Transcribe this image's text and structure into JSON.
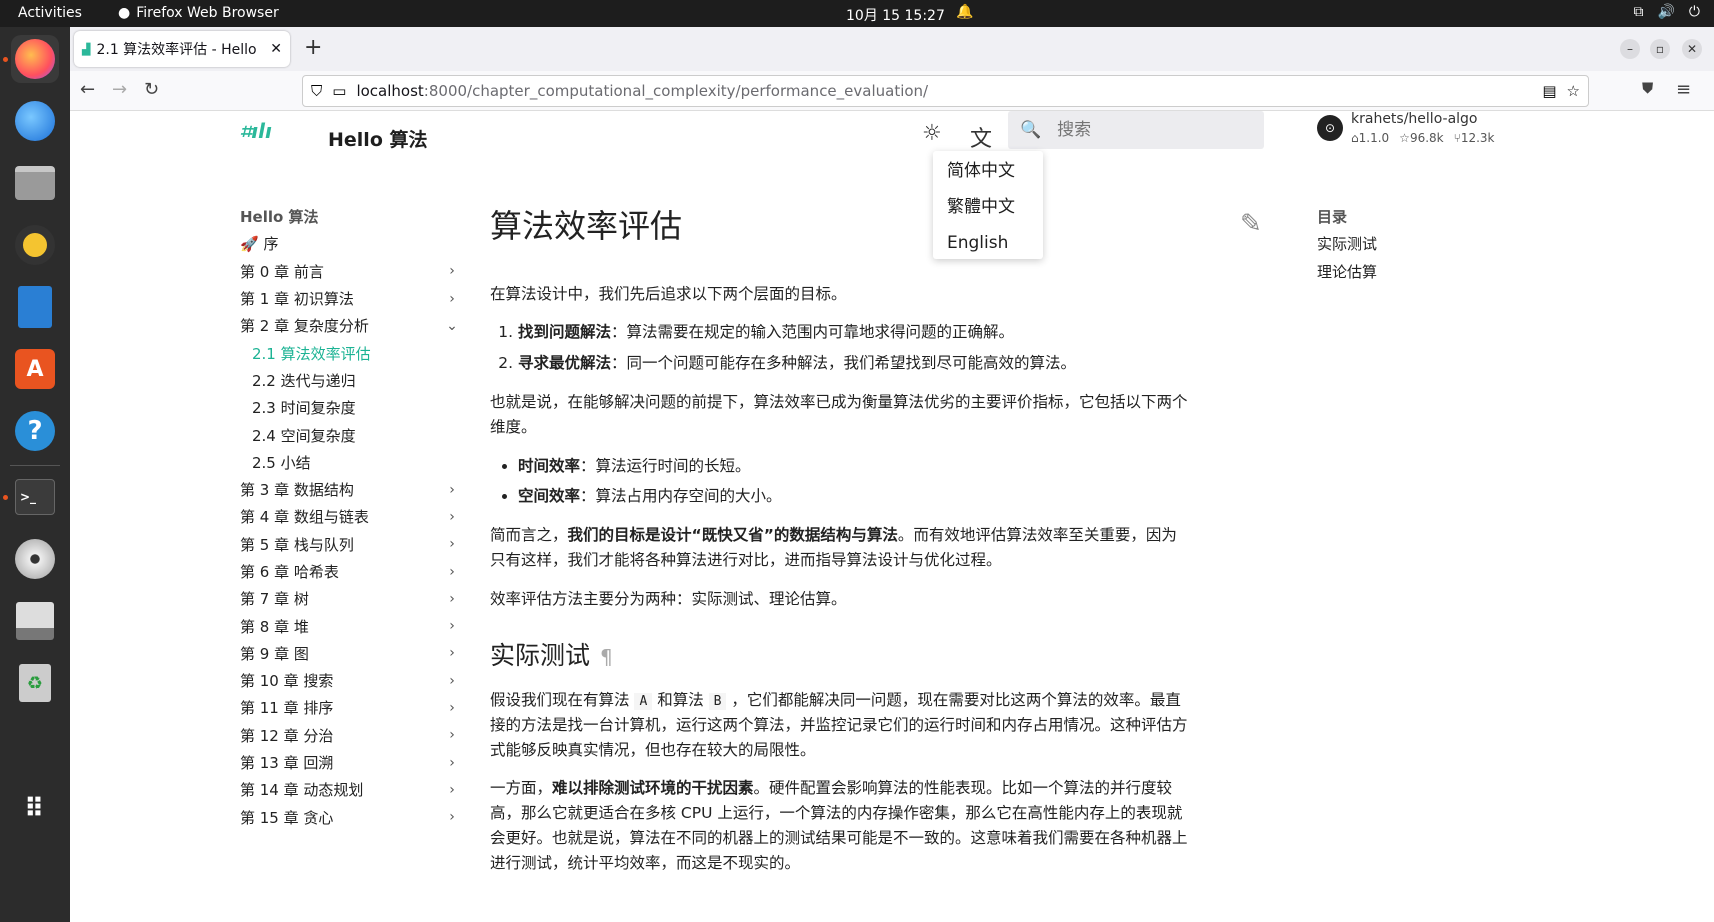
{
  "topbar": {
    "activities": "Activities",
    "app_name": "Firefox Web Browser",
    "clock": "10月 15  15:27"
  },
  "dock": {
    "items": [
      "firefox-icon",
      "thunderbird-icon",
      "files-icon",
      "rhythmbox-icon",
      "writer-icon",
      "app-center-icon",
      "help-icon",
      "terminal-icon",
      "dvd-icon",
      "save-icon",
      "trash-icon",
      "apps-grid-icon"
    ]
  },
  "browser": {
    "tab_title": "2.1  算法效率评估 - Hello",
    "url_host": "localhost",
    "url_path": ":8000/chapter_computational_complexity/performance_evaluation/"
  },
  "header": {
    "site_title": "Hello 算法",
    "search_placeholder": "搜索",
    "repo_name": "krahets/hello-algo",
    "repo_version": "1.1.0",
    "repo_stars": "96.8k",
    "repo_forks": "12.3k"
  },
  "lang_menu": [
    "简体中文",
    "繁體中文",
    "English"
  ],
  "nav": {
    "head": "Hello 算法",
    "items": [
      {
        "label": "序"
      },
      {
        "label": "第 0 章   前言"
      },
      {
        "label": "第 1 章   初识算法"
      },
      {
        "label": "第 2 章   复杂度分析"
      },
      {
        "label": "2.1   算法效率评估"
      },
      {
        "label": "2.2   迭代与递归"
      },
      {
        "label": "2.3   时间复杂度"
      },
      {
        "label": "2.4   空间复杂度"
      },
      {
        "label": "2.5   小结"
      },
      {
        "label": "第 3 章   数据结构"
      },
      {
        "label": "第 4 章   数组与链表"
      },
      {
        "label": "第 5 章   栈与队列"
      },
      {
        "label": "第 6 章   哈希表"
      },
      {
        "label": "第 7 章   树"
      },
      {
        "label": "第 8 章   堆"
      },
      {
        "label": "第 9 章   图"
      },
      {
        "label": "第 10 章   搜索"
      },
      {
        "label": "第 11 章   排序"
      },
      {
        "label": "第 12 章   分治"
      },
      {
        "label": "第 13 章   回溯"
      },
      {
        "label": "第 14 章   动态规划"
      },
      {
        "label": "第 15 章   贪心"
      }
    ]
  },
  "toc": {
    "head": "目录",
    "items": [
      "实际测试",
      "理论估算"
    ]
  },
  "article": {
    "title": "算法效率评估",
    "p1": "在算法设计中，我们先后追求以下两个层面的目标。",
    "ol1_b": "找到问题解法",
    "ol1_t": "：算法需要在规定的输入范围内可靠地求得问题的正确解。",
    "ol2_b": "寻求最优解法",
    "ol2_t": "：同一个问题可能存在多种解法，我们希望找到尽可能高效的算法。",
    "p2": "也就是说，在能够解决问题的前提下，算法效率已成为衡量算法优劣的主要评价指标，它包括以下两个维度。",
    "ul1_b": "时间效率",
    "ul1_t": "：算法运行时间的长短。",
    "ul2_b": "空间效率",
    "ul2_t": "：算法占用内存空间的大小。",
    "p3_a": "简而言之，",
    "p3_b": "我们的目标是设计“既快又省”的数据结构与算法",
    "p3_c": "。而有效地评估算法效率至关重要，因为只有这样，我们才能将各种算法进行对比，进而指导算法设计与优化过程。",
    "p4": "效率评估方法主要分为两种：实际测试、理论估算。",
    "h2": "实际测试",
    "pilcrow": "¶",
    "p5_a": "假设我们现在有算法 ",
    "code_a": "A",
    "p5_b": " 和算法 ",
    "code_b": "B",
    "p5_c": " ，它们都能解决同一问题，现在需要对比这两个算法的效率。最直接的方法是找一台计算机，运行这两个算法，并监控记录它们的运行时间和内存占用情况。这种评估方式能够反映真实情况，但也存在较大的局限性。",
    "p6_a": "一方面，",
    "p6_b": "难以排除测试环境的干扰因素",
    "p6_c": "。硬件配置会影响算法的性能表现。比如一个算法的并行度较高，那么它就更适合在多核 CPU 上运行，一个算法的内存操作密集，那么它在高性能内存上的表现就会更好。也就是说，算法在不同的机器上的测试结果可能是不一致的。这意味着我们需要在各种机器上进行测试，统计平均效率，而这是不现实的。"
  }
}
